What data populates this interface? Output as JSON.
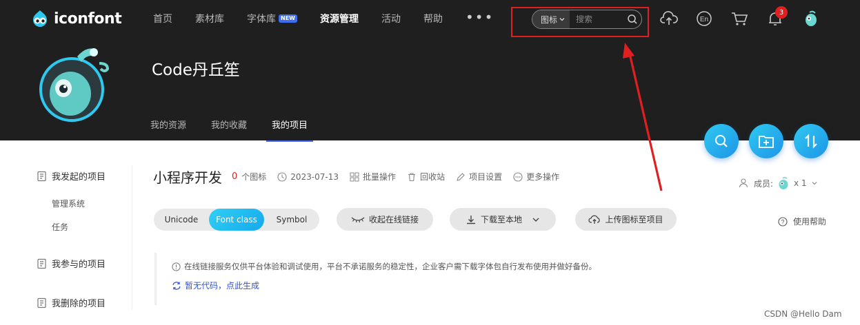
{
  "logo": {
    "text": "iconfont"
  },
  "nav": [
    {
      "label": "首页"
    },
    {
      "label": "素材库"
    },
    {
      "label": "字体库",
      "badge": "NEW"
    },
    {
      "label": "资源管理",
      "active": true
    },
    {
      "label": "活动"
    },
    {
      "label": "帮助"
    }
  ],
  "search": {
    "type_label": "图标",
    "placeholder": "搜索"
  },
  "notifications": {
    "count": "3"
  },
  "profile": {
    "name": "Code丹丘笙"
  },
  "subtabs": [
    {
      "label": "我的资源"
    },
    {
      "label": "我的收藏"
    },
    {
      "label": "我的项目",
      "active": true
    }
  ],
  "sidebar": {
    "groups": [
      {
        "label": "我发起的项目",
        "items": [
          "管理系统",
          "任务"
        ]
      },
      {
        "label": "我参与的项目"
      },
      {
        "label": "我删除的项目"
      }
    ]
  },
  "project": {
    "title": "小程序开发",
    "icon_count": "0",
    "icon_count_label": "个图标",
    "date": "2023-07-13",
    "batch": "批量操作",
    "recycle": "回收站",
    "settings": "项目设置",
    "more": "更多操作"
  },
  "members": {
    "label": "成员:",
    "count": "x 1"
  },
  "format_tabs": [
    {
      "label": "Unicode"
    },
    {
      "label": "Font class",
      "active": true
    },
    {
      "label": "Symbol"
    }
  ],
  "actions": {
    "collapse": "收起在线链接",
    "download": "下载至本地",
    "upload": "上传图标至项目",
    "help": "使用帮助"
  },
  "notice": {
    "text": "在线链接服务仅供平台体验和调试使用，平台不承诺服务的稳定性，企业客户需下载字体包自行发布使用并做好备份。",
    "link": "暂无代码，点此生成"
  },
  "watermark": "CSDN @Hello Dam",
  "colors": {
    "header_bg": "#1f1f1f",
    "accent": "#1ea7ec",
    "highlight_red": "#e02020"
  }
}
